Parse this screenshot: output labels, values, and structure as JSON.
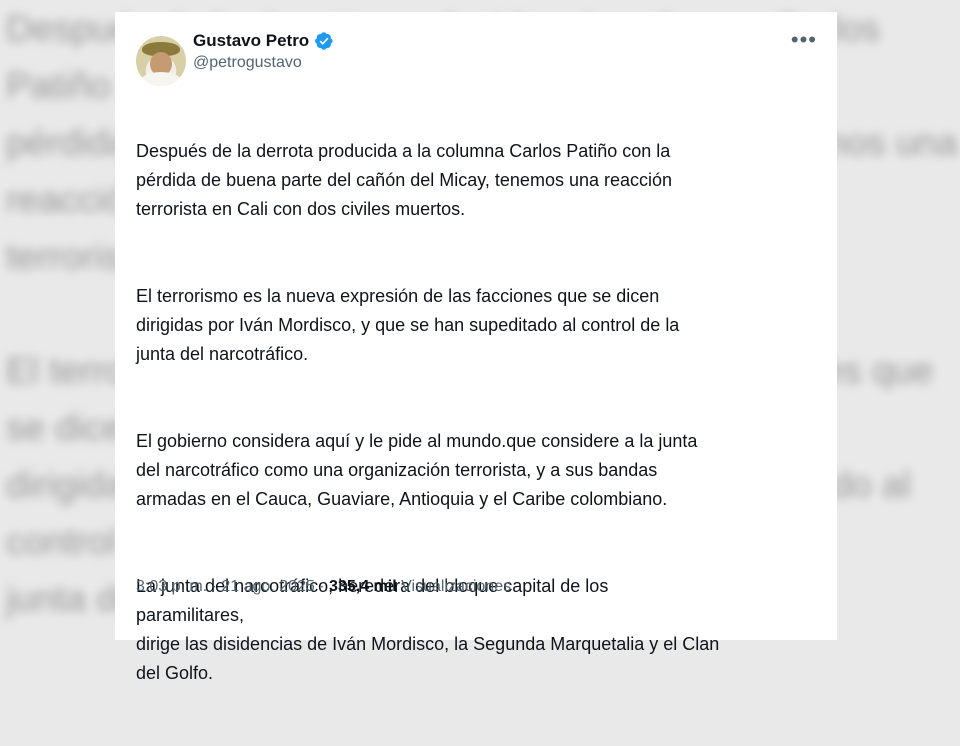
{
  "background_text": "Después de la derrota producida a la columna Carlos Patiño con la\npérdida de buena parte del cañón del Micay, tenemos una reacción\nterrorista\n\nEl terrorismo es la nueva expresión de las facciones que se dicen\ndirigidas por Iván Mordisco, y que se han supeditado al control de la\njunta del narcotráfico.\n\nEl gobierno considera aquí y le pide al mundo.que considere a la junta\ndel narcotráfico como una organización terrorista, y a sus bandas\narmadas en el Cauca, Guaviare, Antioquia y el Caribe colombiano.\n\nLa junta del narcotráfico, heredera del bloque capital de los\nparamilitares,\ndirige las disidencias de Iván Mordisco, la Segunda Marquetalia",
  "tweet": {
    "author_name": "Gustavo Petro",
    "author_handle": "@petrogustavo",
    "verified_icon": "verified-badge-icon",
    "more_icon": "more-options-icon",
    "paragraphs": [
      "Después de la derrota producida a la columna Carlos Patiño con la\npérdida de buena parte del cañón del Micay, tenemos una reacción\nterrorista en Cali con dos civiles muertos.",
      "El terrorismo es la nueva expresión de las facciones que se dicen\ndirigidas por Iván Mordisco, y que se han supeditado al control de la\njunta del narcotráfico.",
      "El gobierno  considera aquí y le pide al mundo.que considere a la junta\ndel narcotráfico como una organización terrorista, y a sus bandas\narmadas en el Cauca, Guaviare, Antioquia y el Caribe colombiano.",
      "La junta del narcotráfico, heredera del bloque capital de los\nparamilitares,\n dirige las disidencias de Iván Mordisco, la Segunda Marquetalia y el Clan\ndel Golfo."
    ],
    "time": "3:03 p. m.",
    "separator": "·",
    "date": "21 ago. 2025",
    "views_count": "335,4 mil",
    "views_label": "Visualizaciones",
    "colors": {
      "text": "#0f1419",
      "secondary": "#536471",
      "verified": "#1d9bf0"
    }
  }
}
